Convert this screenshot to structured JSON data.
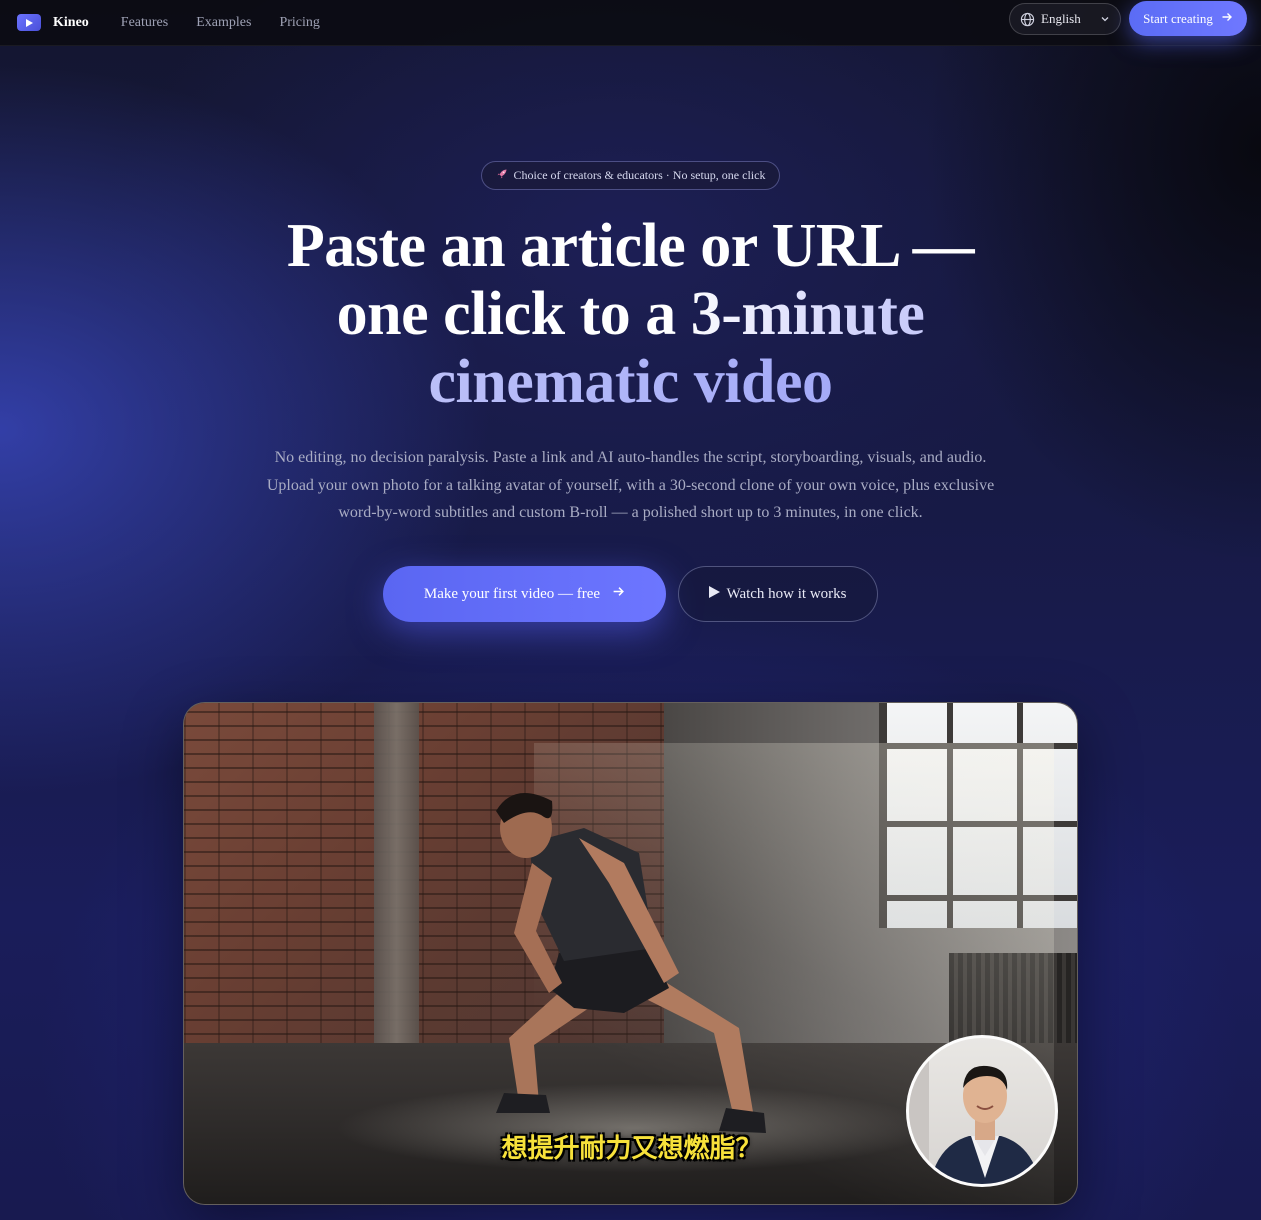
{
  "nav": {
    "brand": "Kineo",
    "links": [
      "Features",
      "Examples",
      "Pricing"
    ],
    "language": "English",
    "cta": "Start creating"
  },
  "hero": {
    "badge_icon": "rocket-icon",
    "badge": "Choice of creators & educators · No setup, one click",
    "headline_line1": "Paste an article or URL —",
    "headline_line2": "one click to a 3-minute",
    "headline_line3": "cinematic video",
    "subtitle": "No editing, no decision paralysis. Paste a link and AI auto-handles the script, storyboarding, visuals, and audio. Upload your own photo for a talking avatar of yourself, with a 30-second clone of your own voice, plus exclusive word-by-word subtitles and custom B-roll — a polished short up to 3 minutes, in one click.",
    "primary_cta": "Make your first video — free",
    "secondary_cta": "Watch how it works"
  },
  "preview": {
    "caption": "想提升耐力又想燃脂？"
  },
  "colors": {
    "accent": "#5b6cf5",
    "accent_light": "#aab0f8",
    "caption": "#f7e13a"
  }
}
